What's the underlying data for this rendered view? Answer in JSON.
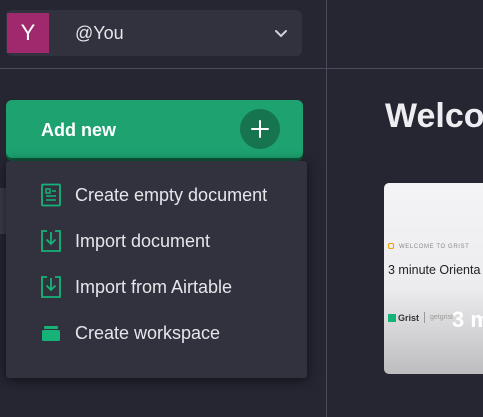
{
  "org": {
    "avatar_letter": "Y",
    "name": "@You",
    "avatar_color": "#a0286c"
  },
  "add_new": {
    "label": "Add new",
    "color": "#1da270"
  },
  "menu": {
    "items": [
      {
        "label": "Create empty document",
        "icon": "document-icon"
      },
      {
        "label": "Import document",
        "icon": "import-icon"
      },
      {
        "label": "Import from Airtable",
        "icon": "import-icon"
      },
      {
        "label": "Create workspace",
        "icon": "folder-icon"
      }
    ]
  },
  "main": {
    "welcome": "Welco",
    "card": {
      "badge": "WELCOME TO GRIST",
      "title": "3 minute Orienta",
      "brand": "Grist",
      "url": "getgrist",
      "overlay": "3 m"
    }
  },
  "colors": {
    "background": "#262633",
    "panel": "#32323f",
    "accent": "#1da270",
    "icon": "#16b378"
  }
}
